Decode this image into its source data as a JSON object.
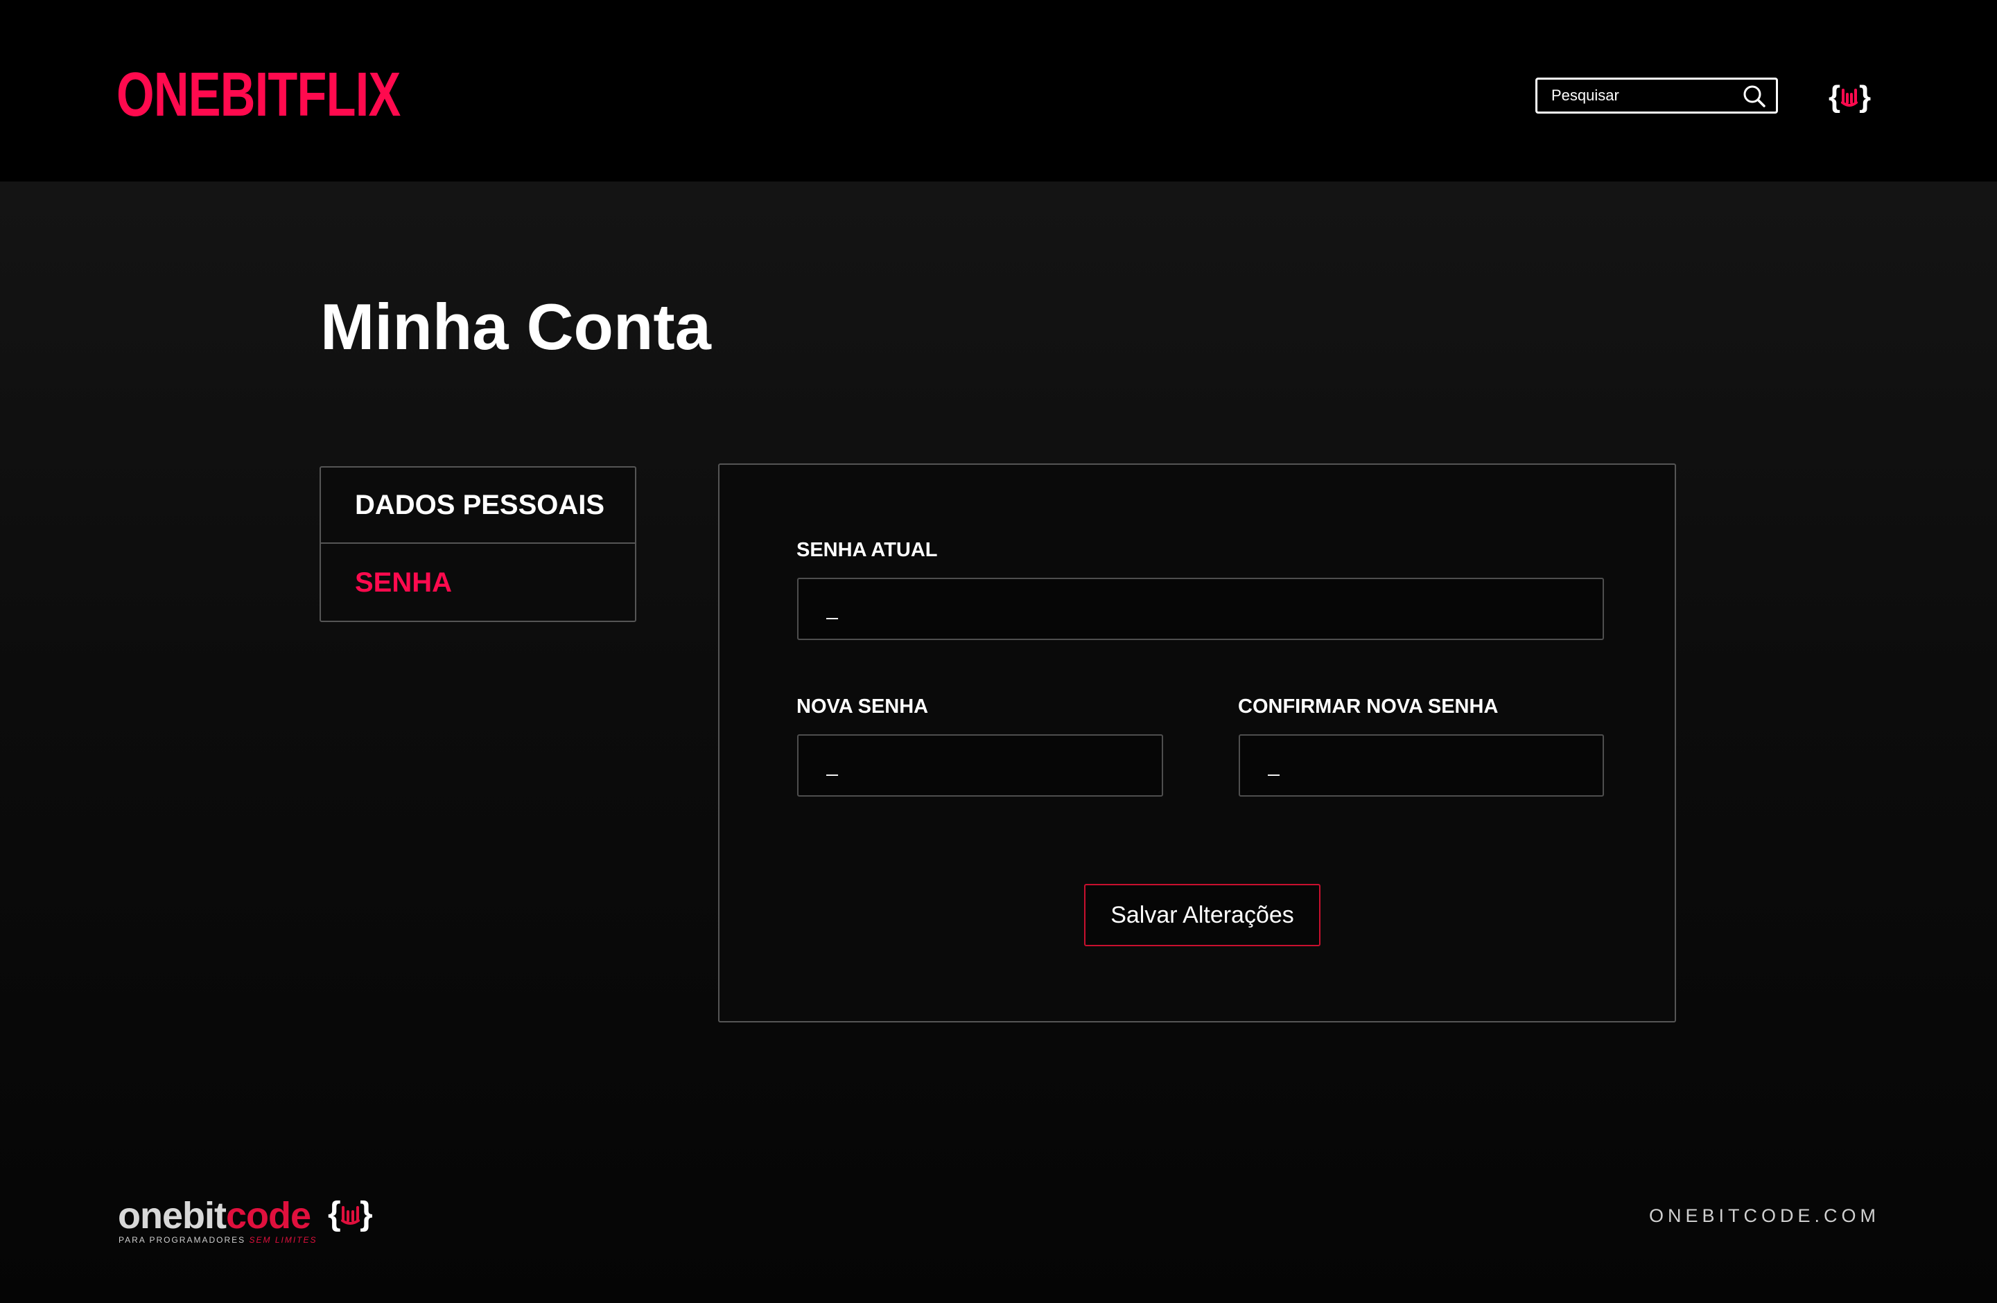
{
  "header": {
    "logo_text": "ONEBITFLIX",
    "search_placeholder": "Pesquisar",
    "search_icon": "search-icon",
    "brand_icon": "onebitcode-brace-hand-icon"
  },
  "main": {
    "title": "Minha Conta",
    "side_menu": {
      "items": [
        {
          "label": "DADOS PESSOAIS",
          "active": false
        },
        {
          "label": "SENHA",
          "active": true
        }
      ]
    },
    "form": {
      "current_password": {
        "label": "SENHA ATUAL",
        "placeholder": "_"
      },
      "new_password": {
        "label": "NOVA SENHA",
        "placeholder": "_"
      },
      "confirm_password": {
        "label": "CONFIRMAR NOVA SENHA",
        "placeholder": "_"
      },
      "save_label": "Salvar Alterações"
    }
  },
  "footer": {
    "logo_part1": "onebit",
    "logo_part2": "code",
    "tagline_part1": "PARA PROGRAMADORES ",
    "tagline_part2": "SEM LIMITES",
    "url": "ONEBITCODE.COM"
  },
  "colors": {
    "accent": "#ff0a4e",
    "background": "#000000",
    "panel_border": "#555555",
    "button_border": "#c8102e"
  }
}
